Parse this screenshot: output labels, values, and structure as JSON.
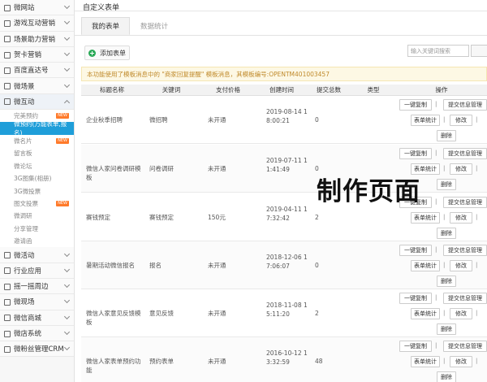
{
  "sidebar": {
    "items": [
      {
        "label": "微网站",
        "icon": "home-icon"
      },
      {
        "label": "游戏互动营销",
        "icon": "gamepad-icon"
      },
      {
        "label": "场景助力营销",
        "icon": "scene-icon"
      },
      {
        "label": "贺卡营销",
        "icon": "card-icon"
      },
      {
        "label": "百度直达号",
        "icon": "baidu-icon"
      },
      {
        "label": "微场景",
        "icon": "scene-icon"
      },
      {
        "label": "微互动",
        "icon": "interact-icon"
      }
    ],
    "subitems": [
      {
        "label": "完美预约",
        "badge": "NEW"
      },
      {
        "label": "微预约(万能表单,报名)",
        "badge": ""
      },
      {
        "label": "微名片",
        "badge": "NEW"
      },
      {
        "label": "留言板",
        "badge": ""
      },
      {
        "label": "微论坛",
        "badge": ""
      },
      {
        "label": "3G图集(相册)",
        "badge": ""
      },
      {
        "label": "3G微投票",
        "badge": ""
      },
      {
        "label": "图文投票",
        "badge": "NEW"
      },
      {
        "label": "微调研",
        "badge": ""
      },
      {
        "label": "分享管理",
        "badge": ""
      },
      {
        "label": "邀请函",
        "badge": ""
      }
    ],
    "items2": [
      {
        "label": "微活动",
        "icon": "activity-icon"
      },
      {
        "label": "行业应用",
        "icon": "industry-icon"
      },
      {
        "label": "摇一摇周边",
        "icon": "shake-icon"
      },
      {
        "label": "微现场",
        "icon": "live-icon"
      },
      {
        "label": "微信商城",
        "icon": "shop-icon"
      },
      {
        "label": "微店系统",
        "icon": "store-icon"
      },
      {
        "label": "微粉丝管理CRM",
        "icon": "fans-icon"
      }
    ]
  },
  "page": {
    "title": "自定义表单",
    "tabs": [
      "我的表单",
      "数据统计"
    ],
    "add_label": "添加表单",
    "search_placeholder": "输入关键词搜索",
    "notice": "本功能使用了模板消息中的 \"商家回复提醒\" 模板消息，其模板编号:OPENTM401003457"
  },
  "table": {
    "headers": [
      "标题名称",
      "关键词",
      "支付价格",
      "创建时间",
      "提交总数",
      "类型",
      "操作"
    ],
    "rows": [
      {
        "title": "企业秋季招聘",
        "keyword": "微招聘",
        "price": "未开通",
        "time": "2019-08-14 18:00:21",
        "count": "0",
        "type": ""
      },
      {
        "title": "微信人家问卷调研模板",
        "keyword": "问卷调研",
        "price": "未开通",
        "time": "2019-07-11 11:41:49",
        "count": "0",
        "type": ""
      },
      {
        "title": "赛钱预定",
        "keyword": "赛钱预定",
        "price": "150元",
        "time": "2019-04-11 17:32:42",
        "count": "2",
        "type": ""
      },
      {
        "title": "暑期活动微信报名",
        "keyword": "报名",
        "price": "未开通",
        "time": "2018-12-06 17:06:07",
        "count": "0",
        "type": ""
      },
      {
        "title": "微信人家意见反馈模板",
        "keyword": "意见反馈",
        "price": "未开通",
        "time": "2018-11-08 15:11:20",
        "count": "2",
        "type": ""
      },
      {
        "title": "微信人家表单预约功能",
        "keyword": "预约表单",
        "price": "未开通",
        "time": "2016-10-12 13:32:59",
        "count": "48",
        "type": ""
      }
    ],
    "ops": {
      "copy": "一键复制",
      "submit_mgr": "提交信息管理",
      "stats": "表单统计",
      "edit": "修改",
      "delete": "删除",
      "sep": "|"
    }
  },
  "watermark": "制作页面",
  "colors": {
    "active_sub": "#1f9ed9",
    "badge": "#ff7a2a",
    "notice_text": "#c08a2b",
    "add_icon": "#2aa957"
  }
}
